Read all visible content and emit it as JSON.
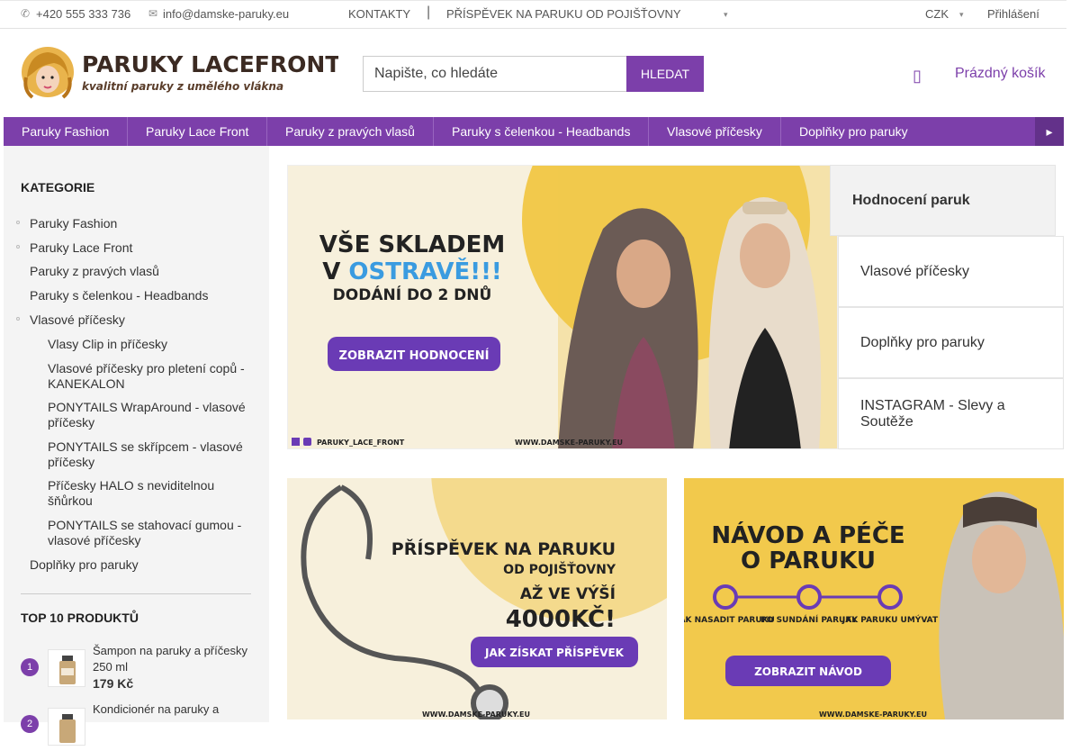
{
  "topbar": {
    "phone": "+420 555 333 736",
    "email": "info@damske-paruky.eu",
    "links": [
      "KONTAKTY",
      "PŘÍSPĚVEK NA PARUKU OD POJIŠŤOVNY"
    ],
    "currency": "CZK",
    "login": "Přihlášení"
  },
  "header": {
    "logo_title": "PARUKY LACEFRONT",
    "logo_subtitle": "kvalitní paruky z umělého vlákna",
    "search_placeholder": "Napište, co hledáte",
    "search_button": "HLEDAT",
    "cart": "Prázdný košík"
  },
  "nav": {
    "items": [
      "Paruky Fashion",
      "Paruky Lace Front",
      "Paruky z pravých vlasů",
      "Paruky s čelenkou - Headbands",
      "Vlasové příčesky",
      "Doplňky pro paruky"
    ]
  },
  "sidebar": {
    "categories_title": "KATEGORIE",
    "categories": [
      "Paruky Fashion",
      "Paruky Lace Front",
      "Paruky z pravých vlasů",
      "Paruky s čelenkou - Headbands",
      "Vlasové příčesky"
    ],
    "subcategories": [
      "Vlasy Clip in příčesky",
      "Vlasové příčesky pro pletení copů - KANEKALON",
      "PONYTAILS WrapAround - vlasové příčesky",
      "PONYTAILS se skřípcem - vlasové příčesky",
      "Příčesky HALO s neviditelnou šňůrkou",
      "PONYTAILS se stahovací gumou - vlasové příčesky"
    ],
    "last_category": "Doplňky pro paruky",
    "top_title": "TOP 10 PRODUKTŮ",
    "top_products": [
      {
        "rank": "1",
        "name": "Šampon na paruky a příčesky 250 ml",
        "price": "179 Kč"
      },
      {
        "rank": "2",
        "name": "Kondicionér na paruky a",
        "price": ""
      }
    ]
  },
  "banner": {
    "line1": "VŠE SKLADEM",
    "line2a": "V ",
    "line2b": "OSTRAVĚ!!!",
    "line3": "DODÁNÍ DO 2 DNŮ",
    "button": "ZOBRAZIT HODNOCENÍ",
    "social": "PARUKY_LACE_FRONT",
    "url": "WWW.DAMSKE-PARUKY.EU"
  },
  "tabs": [
    "Hodnocení paruk",
    "Vlasové příčesky",
    "Doplňky pro paruky",
    "INSTAGRAM - Slevy a Soutěže"
  ],
  "banner2": {
    "line1": "PŘÍSPĚVEK NA PARUKU",
    "line2": "OD POJIŠŤOVNY",
    "line3": "AŽ VE VÝŠÍ",
    "line4": "4000KČ!",
    "button": "JAK ZÍSKAT PŘÍSPĚVEK",
    "url": "WWW.DAMSKE-PARUKY.EU"
  },
  "banner3": {
    "line1": "NÁVOD A PÉČE",
    "line2": "O PARUKU",
    "steps": [
      "JAK NASADIT PARUKU",
      "PO SUNDÁNÍ PARUKY",
      "JAK PARUKU UMÝVAT"
    ],
    "button": "ZOBRAZIT NÁVOD",
    "url": "WWW.DAMSKE-PARUKY.EU"
  },
  "colors": {
    "accent": "#7c3faa",
    "banner_bg": "#f7f0dc",
    "yellow": "#f2c94c"
  },
  "icons": [
    "phone-icon",
    "mail-icon",
    "chevron-down-icon",
    "cart-icon",
    "menu-more-icon"
  ]
}
